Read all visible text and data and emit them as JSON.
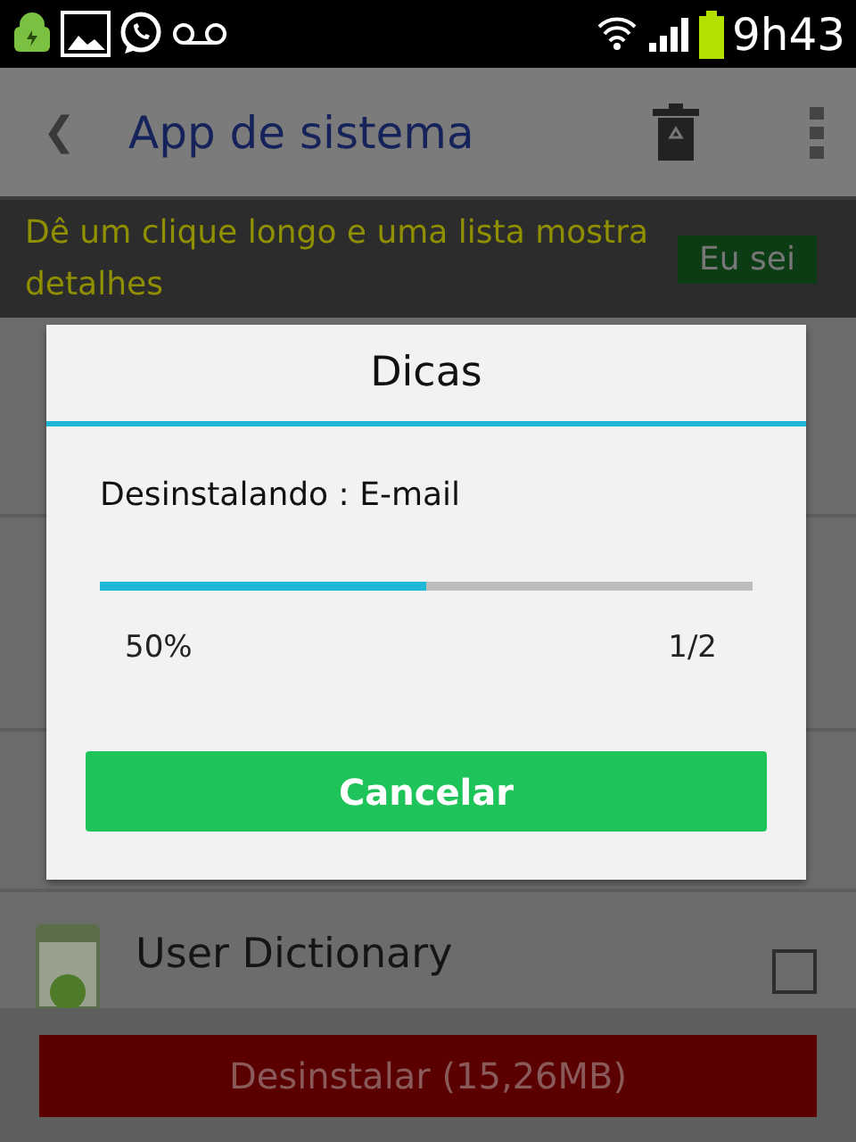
{
  "status_bar": {
    "time": "9h43"
  },
  "toolbar": {
    "back": "❮",
    "title": "App de sistema"
  },
  "tip": {
    "text": "Dê um clique longo e uma lista mostra detalhes",
    "button": "Eu sei"
  },
  "list": [
    {
      "title": "User Dictionary",
      "checked": false
    }
  ],
  "dialog": {
    "title": "Dicas",
    "message": "Desinstalando : E-mail",
    "level": 0.5,
    "percent": "50%",
    "count": "1/2",
    "button": "Cancelar"
  },
  "footer": {
    "button": "Desinstalar (15,26MB)"
  }
}
